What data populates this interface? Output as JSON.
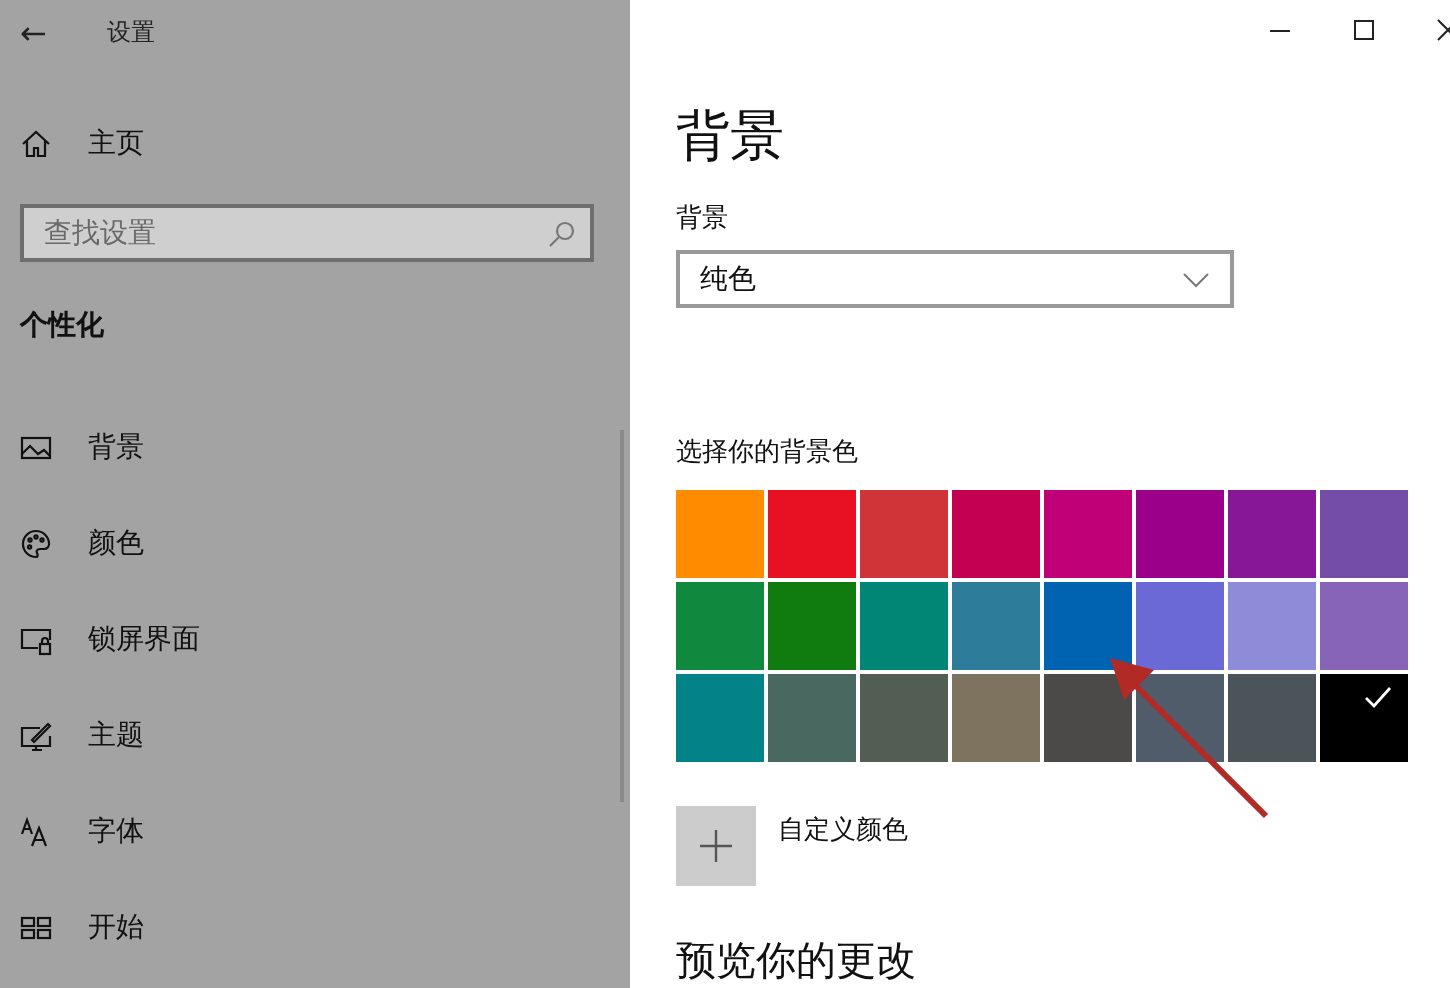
{
  "sidebar": {
    "back": "←",
    "title": "设置",
    "home": "主页",
    "search": {
      "placeholder": "查找设置"
    },
    "section": "个性化",
    "items": [
      {
        "label": "背景"
      },
      {
        "label": "颜色"
      },
      {
        "label": "锁屏界面"
      },
      {
        "label": "主题"
      },
      {
        "label": "字体"
      },
      {
        "label": "开始"
      }
    ]
  },
  "content": {
    "heading": "背景",
    "background_label": "背景",
    "background_select": {
      "value": "纯色"
    },
    "color_label": "选择你的背景色",
    "swatches": [
      {
        "color": "#ff8c00",
        "selected": false
      },
      {
        "color": "#e81123",
        "selected": false
      },
      {
        "color": "#d13438",
        "selected": false
      },
      {
        "color": "#c30052",
        "selected": false
      },
      {
        "color": "#bf0077",
        "selected": false
      },
      {
        "color": "#9a0089",
        "selected": false
      },
      {
        "color": "#881798",
        "selected": false
      },
      {
        "color": "#744da9",
        "selected": false
      },
      {
        "color": "#10893e",
        "selected": false
      },
      {
        "color": "#107c10",
        "selected": false
      },
      {
        "color": "#018574",
        "selected": false
      },
      {
        "color": "#2d7d9a",
        "selected": false
      },
      {
        "color": "#0063b1",
        "selected": false
      },
      {
        "color": "#6b69d6",
        "selected": false
      },
      {
        "color": "#8e8cd8",
        "selected": false
      },
      {
        "color": "#8764b8",
        "selected": false
      },
      {
        "color": "#038387",
        "selected": false
      },
      {
        "color": "#486860",
        "selected": false
      },
      {
        "color": "#525e54",
        "selected": false
      },
      {
        "color": "#7e735f",
        "selected": false
      },
      {
        "color": "#4c4a48",
        "selected": false
      },
      {
        "color": "#515c6b",
        "selected": false
      },
      {
        "color": "#4a5459",
        "selected": false
      },
      {
        "color": "#000000",
        "selected": true
      }
    ],
    "custom_color": "自定义颜色",
    "preview_heading": "预览你的更改"
  }
}
